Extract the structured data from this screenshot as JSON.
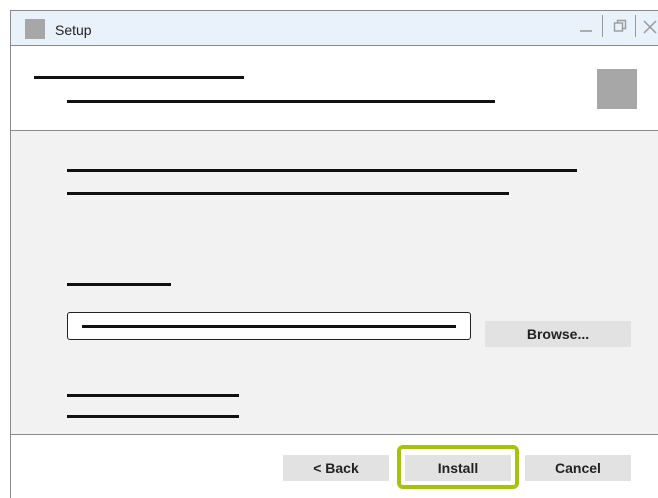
{
  "window": {
    "title": "Setup",
    "controls": [
      "minimize-icon",
      "restore-icon",
      "close-icon"
    ]
  },
  "browse_button": {
    "label": "Browse..."
  },
  "footer": {
    "back_label": "< Back",
    "install_label": "Install",
    "cancel_label": "Cancel"
  },
  "colors": {
    "titlebar": "#e9f1fa",
    "content_bg": "#f2f2f2",
    "button_bg": "#e2e2e2",
    "highlight": "#a8c10f"
  }
}
